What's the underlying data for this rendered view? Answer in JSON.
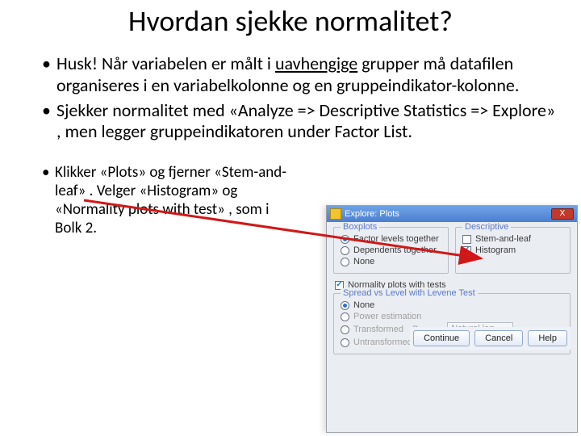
{
  "title": "Hvordan sjekke normalitet?",
  "b1a": "Husk! Når variabelen er målt i ",
  "b1u": "uavhengige",
  "b1b": " grupper må datafilen organiseres i en variabelkolonne og en gruppeindikator-kolonne.",
  "b2": "Sjekker normalitet med «Analyze => Descriptive Statistics => Explore» , men legger gruppeindikatoren under Factor List.",
  "b3": "Klikker «Plots» og fjerner «Stem-and-leaf» . Velger «Histogram» og «Normality plots with test» , som i Bolk 2.",
  "dlg": {
    "title": "Explore: Plots",
    "close": "X",
    "boxplots": {
      "legend": "Boxplots",
      "o1": "Factor levels together",
      "o2": "Dependents together",
      "o3": "None"
    },
    "descriptive": {
      "legend": "Descriptive",
      "c1": "Stem-and-leaf",
      "c2": "Histogram"
    },
    "norm": "Normality plots with tests",
    "spread": {
      "legend": "Spread vs Level with Levene Test",
      "o1": "None",
      "o2": "Power estimation",
      "o3": "Transformed",
      "powlabel": "Power:",
      "powval": "Natural log",
      "o4": "Untransformed"
    },
    "btn": {
      "cont": "Continue",
      "cancel": "Cancel",
      "help": "Help"
    }
  }
}
